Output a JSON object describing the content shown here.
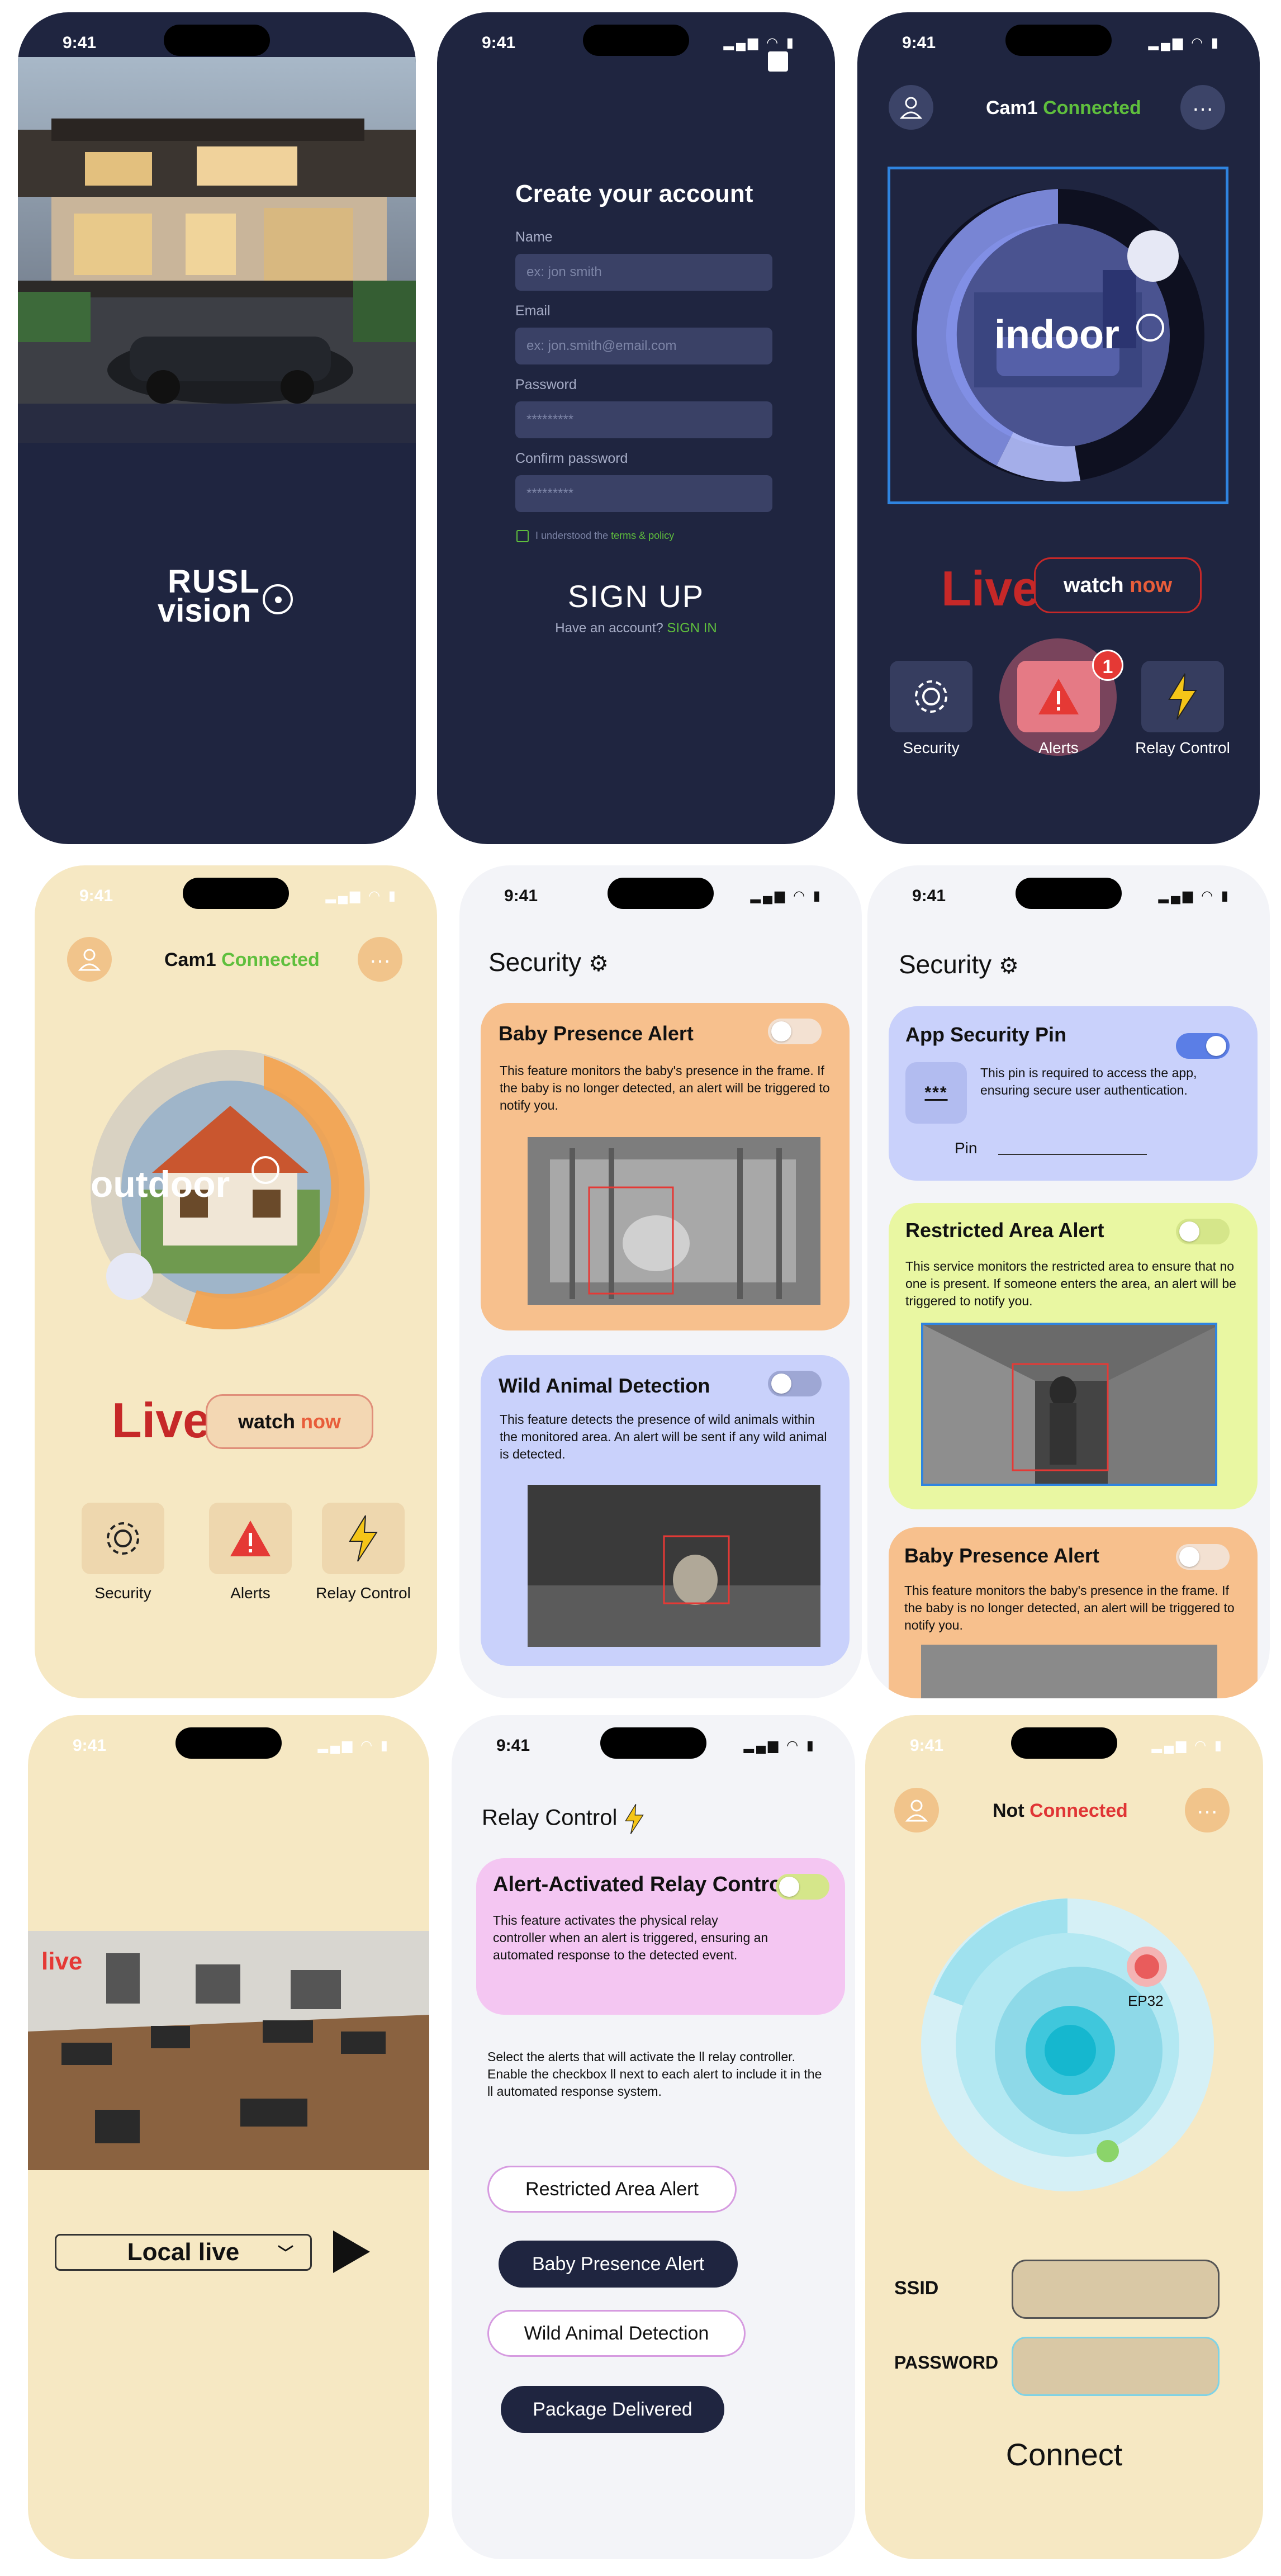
{
  "colors": {
    "dark_bg": "#1f2540",
    "cream_bg": "#f6e8c3",
    "connected_green": "#5fbf3d",
    "not_connected_red": "#e03535",
    "live_red": "#c62828",
    "orange_card": "#f7c08d",
    "blue_card": "#c9d1fb",
    "yellow_card": "#e9f7a2",
    "pink_card": "#f4c6f2",
    "navy_pill": "#1f2540"
  },
  "status": {
    "time": "9:41"
  },
  "screen1": {
    "logo_line1": "RUSL",
    "logo_line2": "vision"
  },
  "screen2": {
    "title": "Create your account",
    "name_label": "Name",
    "name_placeholder": "ex: jon smith",
    "email_label": "Email",
    "email_placeholder": "ex: jon.smith@email.com",
    "password_label": "Password",
    "password_value": "*********",
    "confirm_label": "Confirm password",
    "confirm_value": "*********",
    "terms_text": "I understood the",
    "terms_link": "terms & policy",
    "signup": "SIGN UP",
    "have_account": "Have an account?",
    "signin": "SIGN IN"
  },
  "screen3": {
    "cam": "Cam1",
    "connected": "Connected",
    "mode": "indoor",
    "live": "Live",
    "watch": "watch",
    "now": "now",
    "badge": "1",
    "tabs": [
      {
        "label": "Security",
        "icon": "gear-icon"
      },
      {
        "label": "Alerts",
        "icon": "alert-icon"
      },
      {
        "label": "Relay Control",
        "icon": "lightning-icon"
      }
    ]
  },
  "screen4": {
    "cam": "Cam1",
    "connected": "Connected",
    "mode": "outdoor",
    "live": "Live",
    "watch": "watch",
    "now": "now",
    "tabs": [
      {
        "label": "Security",
        "icon": "gear-icon"
      },
      {
        "label": "Alerts",
        "icon": "alert-icon"
      },
      {
        "label": "Relay Control",
        "icon": "lightning-icon"
      }
    ]
  },
  "screen5": {
    "title": "Security",
    "baby": {
      "title": "Baby Presence Alert",
      "text": "This feature monitors the baby's presence in the frame.  If the baby is no longer detected, an alert will be triggered to notify you.",
      "on": false
    },
    "wild": {
      "title": "Wild Animal Detection",
      "text": "This feature detects the presence of wild animals within the monitored area. An alert  will be sent if any wild animal is detected.",
      "on": false
    }
  },
  "screen6": {
    "title": "Security",
    "pin": {
      "title": "App Security Pin",
      "text": "This pin is required to access  the app, ensuring secure user authentication.",
      "pin_label": "Pin",
      "stars": "***",
      "on": true
    },
    "restricted": {
      "title": "Restricted Area Alert",
      "text": "This service monitors the restricted area to ensure that no one is present. If someone  enters the area, an alert will be triggered to notify you.",
      "on": false
    },
    "baby": {
      "title": "Baby Presence Alert",
      "text": "This feature monitors the baby's presence in the frame.  If the baby is no longer detected, an alert will be triggered to notify you.",
      "on": false
    }
  },
  "screen7": {
    "live": "live",
    "source": "Local live"
  },
  "screen8": {
    "title": "Relay Control",
    "card": {
      "title": "Alert-Activated Relay Control",
      "text": "This feature activates the physical  relay controller when an alert is  triggered, ensuring an automated response to the detected event.",
      "on": true
    },
    "instructions": "Select the alerts that will activate the  ll relay controller. Enable the checkbox   ll next to each alert to include it in the  ll automated response system.",
    "options": [
      {
        "label": "Restricted Area Alert",
        "selected": false
      },
      {
        "label": "Baby Presence Alert",
        "selected": true
      },
      {
        "label": "Wild Animal Detection",
        "selected": false
      },
      {
        "label": "Package Delivered",
        "selected": true
      }
    ]
  },
  "screen9": {
    "not": "Not",
    "connected": "Connected",
    "device": "EP32",
    "ssid": "SSID",
    "password": "PASSWORD",
    "connect": "Connect"
  }
}
